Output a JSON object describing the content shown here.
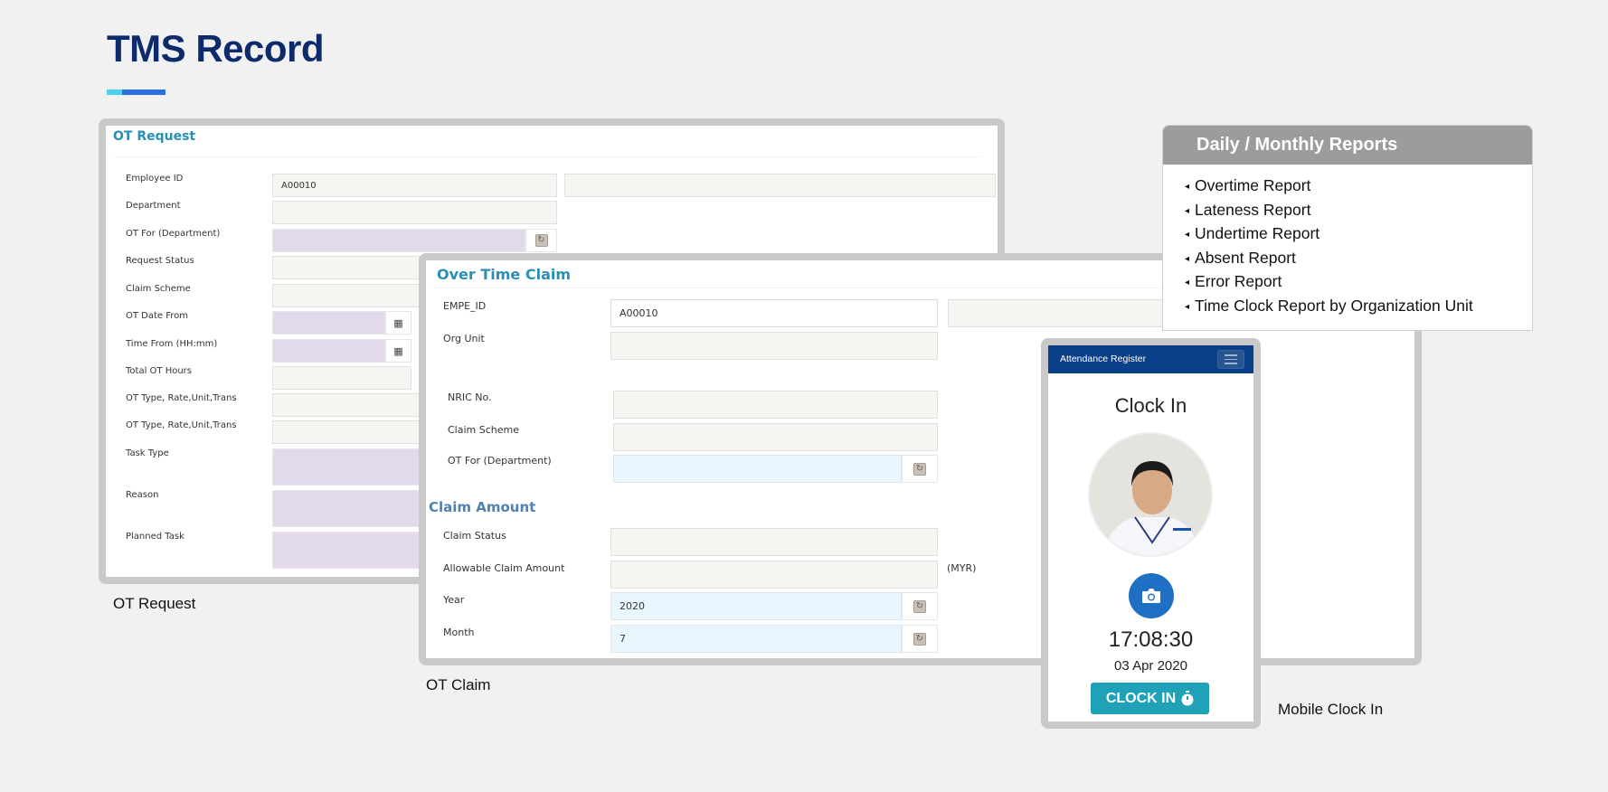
{
  "page": {
    "title": "TMS Record",
    "accent_colors": {
      "title": "#0d2a6b",
      "bar_light": "#4fd0f0",
      "bar_dark": "#2b6fe0"
    }
  },
  "ot_request": {
    "title": "OT Request",
    "caption": "OT Request",
    "fields": [
      {
        "label": "Employee ID",
        "value": "A00010",
        "extra_value": ""
      },
      {
        "label": "Department",
        "value": ""
      },
      {
        "label": "OT For (Department)",
        "value": "",
        "addon": "refresh-icon"
      },
      {
        "label": "Request Status",
        "value": ""
      },
      {
        "label": "Claim Scheme",
        "value": ""
      },
      {
        "label": "OT Date From",
        "value": "",
        "addon": "calendar-icon"
      },
      {
        "label": "Time From (HH:mm)",
        "value": "",
        "addon": "calendar-icon"
      },
      {
        "label": "Total OT Hours",
        "value": ""
      },
      {
        "label": "OT Type, Rate,Unit,Trans",
        "value": ""
      },
      {
        "label": "OT Type, Rate,Unit,Trans",
        "value": ""
      },
      {
        "label": "Task Type",
        "value": ""
      },
      {
        "label": "Reason",
        "value": ""
      },
      {
        "label": "Planned Task",
        "value": ""
      }
    ]
  },
  "ot_claim": {
    "title": "Over Time Claim",
    "caption": "OT Claim",
    "fields": [
      {
        "label": "EMPE_ID",
        "value": "A00010",
        "extra_value": ""
      },
      {
        "label": "Org Unit",
        "value": ""
      },
      {
        "label": "NRIC No.",
        "value": ""
      },
      {
        "label": "Claim Scheme",
        "value": ""
      },
      {
        "label": "OT For (Department)",
        "value": "",
        "addon": "refresh-icon"
      }
    ],
    "claim_amount": {
      "title": "Claim Amount",
      "fields": [
        {
          "label": "Claim Status",
          "value": ""
        },
        {
          "label": "Allowable Claim Amount",
          "value": "",
          "unit": "(MYR)"
        },
        {
          "label": "Year",
          "value": "2020",
          "addon": "refresh-icon"
        },
        {
          "label": "Month",
          "value": "7",
          "addon": "refresh-icon"
        }
      ]
    }
  },
  "reports": {
    "title": "Daily / Monthly Reports",
    "bullet_glyph": "◂",
    "items": [
      "Overtime Report",
      "Lateness Report",
      "Undertime Report",
      "Absent Report",
      "Error Report",
      "Time Clock Report by Organization Unit"
    ]
  },
  "mobile": {
    "caption": "Mobile Clock In",
    "nav_title": "Attendance Register",
    "heading": "Clock In",
    "time": "17:08:30",
    "date": "03 Apr 2020",
    "button_label": "CLOCK IN",
    "button_color": "#1fa2b8"
  }
}
